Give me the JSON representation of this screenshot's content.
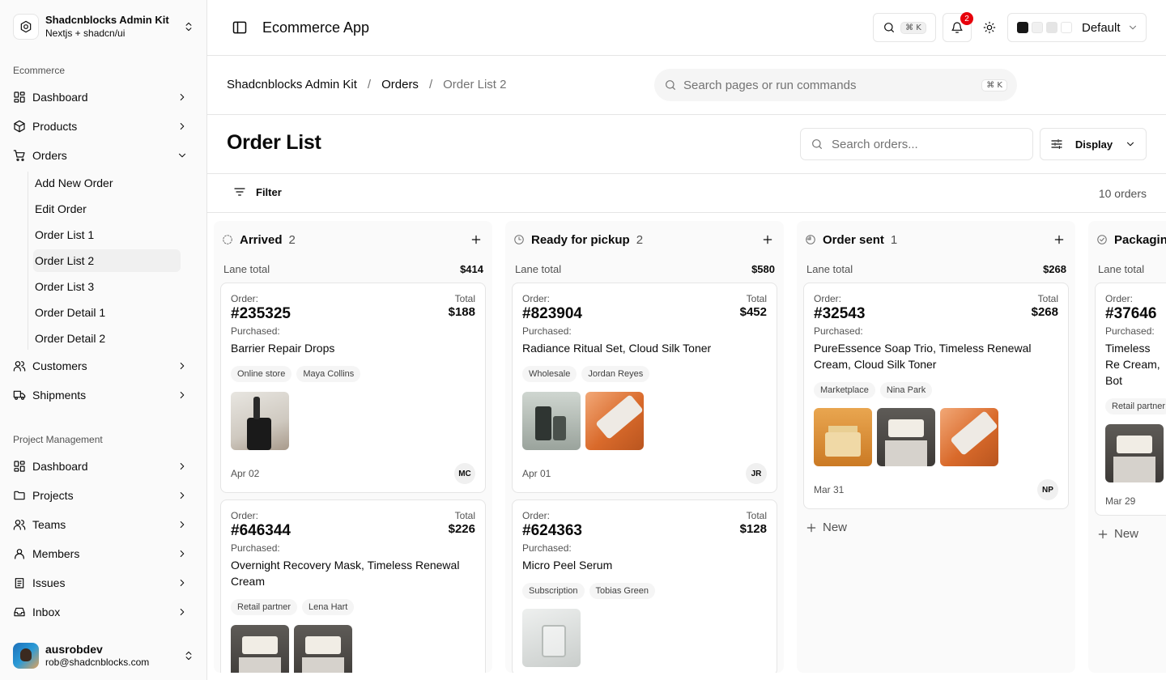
{
  "sidebar": {
    "team": {
      "name": "Shadcnblocks Admin Kit",
      "subtitle": "Nextjs + shadcn/ui"
    },
    "sections": [
      {
        "label": "Ecommerce"
      },
      {
        "label": "Project Management"
      }
    ],
    "ecommerce": {
      "dashboard": "Dashboard",
      "products": "Products",
      "orders": "Orders",
      "orders_sub": [
        "Add New Order",
        "Edit Order",
        "Order List 1",
        "Order List 2",
        "Order List 3",
        "Order Detail 1",
        "Order Detail 2"
      ],
      "customers": "Customers",
      "shipments": "Shipments"
    },
    "pm": {
      "dashboard": "Dashboard",
      "projects": "Projects",
      "teams": "Teams",
      "members": "Members",
      "issues": "Issues",
      "inbox": "Inbox"
    },
    "user": {
      "name": "ausrobdev",
      "email": "rob@shadcnblocks.com"
    }
  },
  "header": {
    "app_title": "Ecommerce App",
    "search_kbd": "⌘ K",
    "notif_count": "2",
    "theme_label": "Default",
    "swatch_colors": [
      "#171717",
      "#f0f0f0",
      "#e5e5e5",
      "#ffffff"
    ]
  },
  "breadcrumb": {
    "items": [
      "Shadcnblocks Admin Kit",
      "Orders",
      "Order List 2"
    ],
    "separator": "/",
    "search_placeholder": "Search pages or run commands",
    "search_kbd": "⌘ K"
  },
  "page": {
    "title": "Order List",
    "search_placeholder": "Search orders...",
    "display_label": "Display",
    "filter_label": "Filter",
    "order_count": "10 orders"
  },
  "board": {
    "lane_total_label": "Lane total",
    "order_label": "Order:",
    "total_label": "Total",
    "purchased_label": "Purchased:",
    "new_label": "New",
    "lanes": [
      {
        "name": "Arrived",
        "count": "2",
        "total": "$414",
        "cards": [
          {
            "order": "#235325",
            "total": "$188",
            "products": "Barrier Repair Drops",
            "tags": [
              "Online store",
              "Maya Collins"
            ],
            "images": [
              "serum"
            ],
            "date": "Apr 02",
            "initials": "MC"
          },
          {
            "order": "#646344",
            "total": "$226",
            "products": "Overnight Recovery Mask, Timeless Renewal Cream",
            "tags": [
              "Retail partner",
              "Lena Hart"
            ],
            "images": [
              "jar",
              "jar"
            ],
            "date": "",
            "initials": ""
          }
        ]
      },
      {
        "name": "Ready for pickup",
        "count": "2",
        "total": "$580",
        "cards": [
          {
            "order": "#823904",
            "total": "$452",
            "products": "Radiance Ritual Set, Cloud Silk Toner",
            "tags": [
              "Wholesale",
              "Jordan Reyes"
            ],
            "images": [
              "set",
              "tube"
            ],
            "date": "Apr 01",
            "initials": "JR"
          },
          {
            "order": "#624363",
            "total": "$128",
            "products": "Micro Peel Serum",
            "tags": [
              "Subscription",
              "Tobias Green"
            ],
            "images": [
              "glass"
            ],
            "date": "",
            "initials": ""
          }
        ]
      },
      {
        "name": "Order sent",
        "count": "1",
        "total": "$268",
        "cards": [
          {
            "order": "#32543",
            "total": "$268",
            "products": "PureEssence Soap Trio, Timeless Renewal Cream, Cloud Silk Toner",
            "tags": [
              "Marketplace",
              "Nina Park"
            ],
            "images": [
              "soap",
              "jar",
              "tube"
            ],
            "date": "Mar 31",
            "initials": "NP"
          }
        ]
      },
      {
        "name": "Packagin",
        "count": "",
        "total": "",
        "cards": [
          {
            "order": "#37646",
            "total": "",
            "products": "Timeless Re Cream, Bot",
            "tags": [
              "Retail partner"
            ],
            "images": [
              "jar"
            ],
            "date": "Mar 29",
            "initials": ""
          }
        ]
      }
    ]
  }
}
